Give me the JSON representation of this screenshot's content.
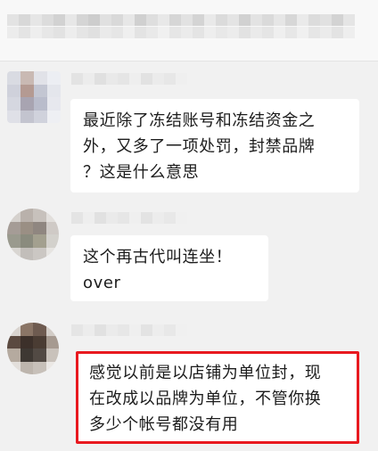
{
  "messages": [
    {
      "lines": [
        "最近除了冻结账号和冻结资金之",
        "外，又多了一项处罚，封禁品牌",
        "？这是什么意思"
      ],
      "highlighted": false
    },
    {
      "lines": [
        "这个再古代叫连坐！",
        "over"
      ],
      "highlighted": false
    },
    {
      "lines": [
        "感觉以前是以店铺为单位封，现",
        "在改成以品牌为单位，不管你换",
        "多少个帐号都没有用"
      ],
      "highlighted": true
    }
  ],
  "colors": {
    "background": "#f1f1f1",
    "bubble": "#ffffff",
    "highlight_border": "#e8191f"
  }
}
